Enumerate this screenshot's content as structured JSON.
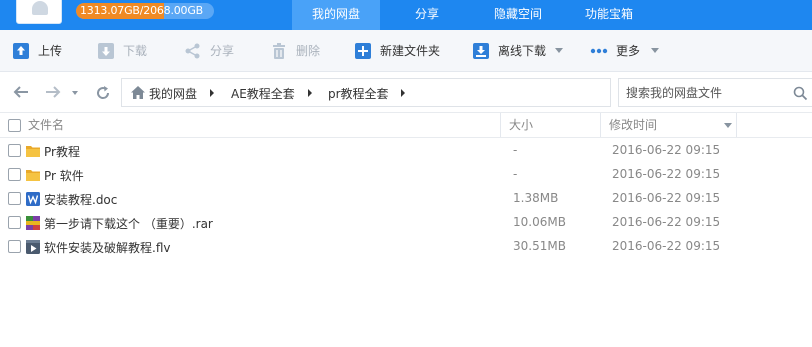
{
  "header": {
    "quota_text": "1313.07GB/2068.00GB",
    "quota_used_fraction": 0.635,
    "nav": [
      "我的网盘",
      "分享",
      "隐藏空间",
      "功能宝箱"
    ],
    "active_nav": "我的网盘"
  },
  "toolbar": {
    "upload": "上传",
    "download": "下载",
    "share": "分享",
    "delete": "删除",
    "new_folder": "新建文件夹",
    "offline_download": "离线下载",
    "more": "更多"
  },
  "breadcrumb": [
    "我的网盘",
    "AE教程全套",
    "pr教程全套"
  ],
  "search": {
    "placeholder": "搜索我的网盘文件"
  },
  "columns": {
    "name": "文件名",
    "size": "大小",
    "modified": "修改时间"
  },
  "files": [
    {
      "name": "Pr教程",
      "type": "folder",
      "size": "-",
      "modified": "2016-06-22 09:15"
    },
    {
      "name": "Pr 软件",
      "type": "folder",
      "size": "-",
      "modified": "2016-06-22 09:15"
    },
    {
      "name": "安装教程.doc",
      "type": "doc",
      "size": "1.38MB",
      "modified": "2016-06-22 09:15"
    },
    {
      "name": "第一步请下载这个 （重要）.rar",
      "type": "rar",
      "size": "10.06MB",
      "modified": "2016-06-22 09:15"
    },
    {
      "name": "软件安装及破解教程.flv",
      "type": "video",
      "size": "30.51MB",
      "modified": "2016-06-22 09:15"
    }
  ],
  "colors": {
    "brand_blue": "#1e87f0",
    "active_tab": "#49a2f8",
    "quota_used": "#f08a24",
    "folder": "#f5c342"
  }
}
